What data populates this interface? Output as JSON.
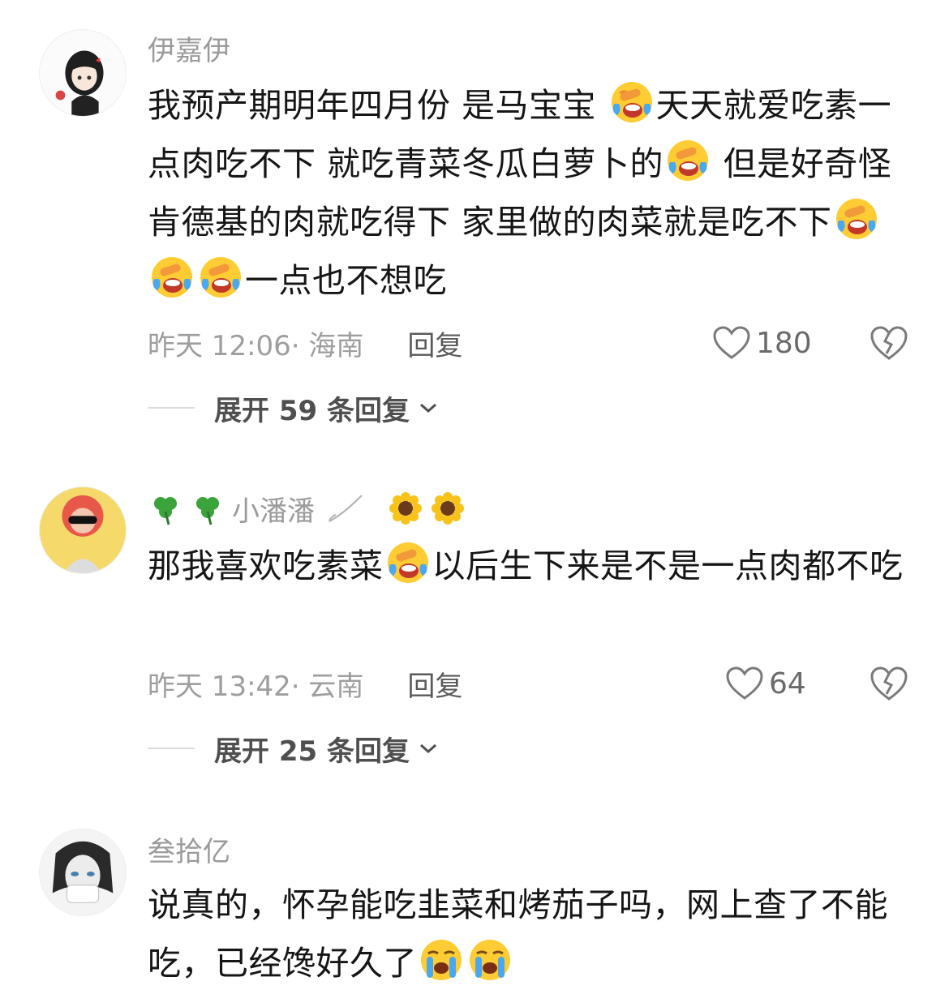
{
  "comments": [
    {
      "username": "伊嘉伊",
      "text_segments": [
        "我预产期明年四月份 是马宝宝 ",
        "天天就爱吃素一点肉吃不下 就吃青菜冬瓜白萝卜的",
        " 但是好奇怪 肯德基的肉就吃得下 家里做的肉菜就是吃不下",
        "一点也不想吃"
      ],
      "emoji_name": "tears-of-joy",
      "timestamp": "昨天 12:06",
      "location": "· 海南",
      "reply_label": "回复",
      "likes": "180",
      "expand_label": "展开 59 条回复"
    },
    {
      "username_prefix_icons": [
        "shamrock",
        "shamrock"
      ],
      "username": "小潘潘",
      "username_suffix_icons": [
        "sunflower",
        "sunflower"
      ],
      "text_segments": [
        "那我喜欢吃素菜",
        "以后生下来是不是一点肉都不吃"
      ],
      "emoji_name": "tears-of-joy",
      "timestamp": "昨天 13:42",
      "location": "· 云南",
      "reply_label": "回复",
      "likes": "64",
      "expand_label": "展开 25 条回复"
    },
    {
      "username": "叁拾亿",
      "text_segments": [
        "说真的，怀孕能吃韭菜和烤茄子吗，网上查了不能吃，已经馋好久了"
      ],
      "emoji_name": "loudly-crying"
    }
  ],
  "colors": {
    "username": "#9b9b9b",
    "body": "#161616",
    "meta": "#9e9e9e",
    "reply": "#5a5a5a",
    "expand": "#4f4f4f"
  }
}
